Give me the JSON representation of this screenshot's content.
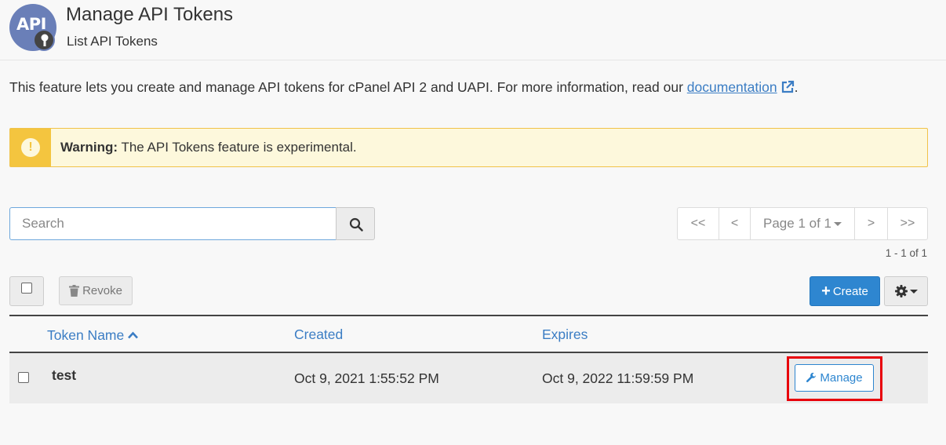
{
  "header": {
    "logo_text": "API",
    "title": "Manage API Tokens",
    "subtitle": "List API Tokens"
  },
  "intro": {
    "text": "This feature lets you create and manage API tokens for cPanel API 2 and UAPI. For more information, read our ",
    "link_text": "documentation",
    "suffix": "."
  },
  "warning": {
    "icon": "exclamation-icon",
    "label": "Warning:",
    "message": " The API Tokens feature is experimental."
  },
  "search": {
    "placeholder": "Search",
    "value": ""
  },
  "pagination": {
    "first": "<<",
    "prev": "<",
    "page_label": "Page 1 of 1",
    "next": ">",
    "last": ">>",
    "count": "1 - 1 of 1"
  },
  "toolbar": {
    "revoke_label": "Revoke",
    "create_label": "Create"
  },
  "table": {
    "columns": [
      "Token Name",
      "Created",
      "Expires"
    ],
    "rows": [
      {
        "name": "test",
        "created": "Oct 9, 2021 1:55:52 PM",
        "expires": "Oct 9, 2022 11:59:59 PM",
        "action": "Manage"
      }
    ]
  },
  "colors": {
    "accent": "#2e86d0",
    "link": "#3b7dc4",
    "warning": "#f4c53f",
    "highlight": "#e8000b"
  }
}
